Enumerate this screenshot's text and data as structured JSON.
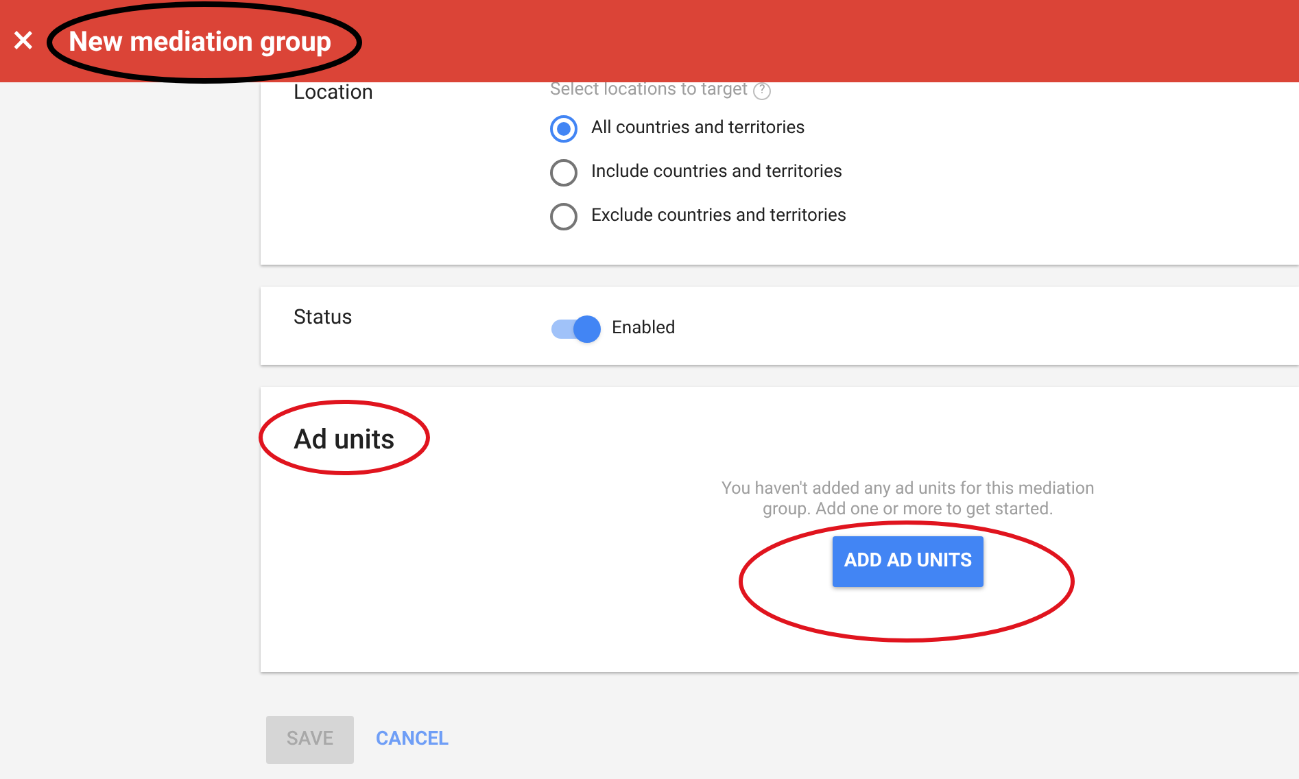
{
  "header": {
    "close": "×",
    "title": "New mediation group"
  },
  "location": {
    "label": "Location",
    "hint": "Select locations to target",
    "help": "?",
    "options": [
      {
        "label": "All countries and territories",
        "selected": true
      },
      {
        "label": "Include countries and territories",
        "selected": false
      },
      {
        "label": "Exclude countries and territories",
        "selected": false
      }
    ]
  },
  "status": {
    "label": "Status",
    "on": true,
    "value": "Enabled"
  },
  "ad_units": {
    "title": "Ad units",
    "message": "You haven't added any ad units for this mediation group. Add one or more to get started.",
    "button": "ADD AD UNITS"
  },
  "actions": [
    {
      "label": "SAVE",
      "kind": "raised",
      "disabled": true
    },
    {
      "label": "CANCEL",
      "kind": "flat",
      "disabled": false
    }
  ]
}
